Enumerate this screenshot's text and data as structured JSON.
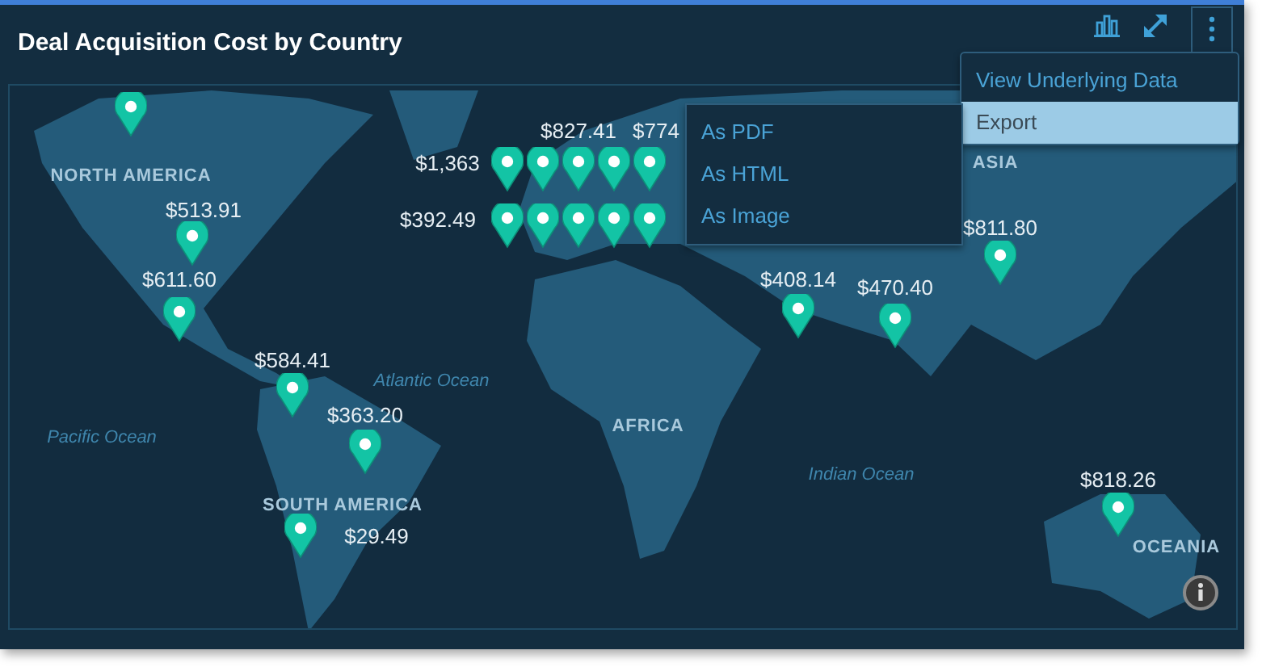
{
  "widget": {
    "title": "Deal Acquisition Cost by Country"
  },
  "menu": {
    "items": [
      {
        "label": "View Underlying Data",
        "selected": false
      },
      {
        "label": "Export",
        "selected": true
      }
    ]
  },
  "submenu": {
    "items": [
      {
        "label": "As PDF"
      },
      {
        "label": "As HTML"
      },
      {
        "label": "As Image"
      }
    ]
  },
  "map": {
    "regions": [
      {
        "kind": "continent",
        "label": "NORTH AMERICA"
      },
      {
        "kind": "continent",
        "label": "SOUTH AMERICA"
      },
      {
        "kind": "continent",
        "label": "AFRICA"
      },
      {
        "kind": "continent",
        "label": "ASIA"
      },
      {
        "kind": "continent",
        "label": "OCEANIA"
      },
      {
        "kind": "ocean",
        "label": "Pacific Ocean"
      },
      {
        "kind": "ocean",
        "label": "Atlantic Ocean"
      },
      {
        "kind": "ocean",
        "label": "Indian Ocean"
      }
    ],
    "markers": [
      {
        "kind": "pin"
      },
      {
        "kind": "labeled",
        "label": "$513.91"
      },
      {
        "kind": "labeled",
        "label": "$611.60"
      },
      {
        "kind": "labeled",
        "label": "$584.41"
      },
      {
        "kind": "labeled",
        "label": "$363.20"
      },
      {
        "kind": "labeled",
        "label": "$29.49"
      },
      {
        "kind": "pin"
      },
      {
        "kind": "labeled",
        "label": "$827.41"
      },
      {
        "kind": "labeled",
        "label": "$1,363"
      },
      {
        "kind": "labeled",
        "label": "$392.49"
      },
      {
        "kind": "pin"
      },
      {
        "kind": "labeled",
        "label": "$774"
      },
      {
        "kind": "pin"
      },
      {
        "kind": "pin"
      },
      {
        "kind": "pin"
      },
      {
        "kind": "pin"
      },
      {
        "kind": "labeled",
        "label": "$408.14"
      },
      {
        "kind": "labeled",
        "label": "$470.40"
      },
      {
        "kind": "labeled",
        "label": "$811.80"
      },
      {
        "kind": "labeled",
        "label": "$818.26"
      }
    ]
  }
}
